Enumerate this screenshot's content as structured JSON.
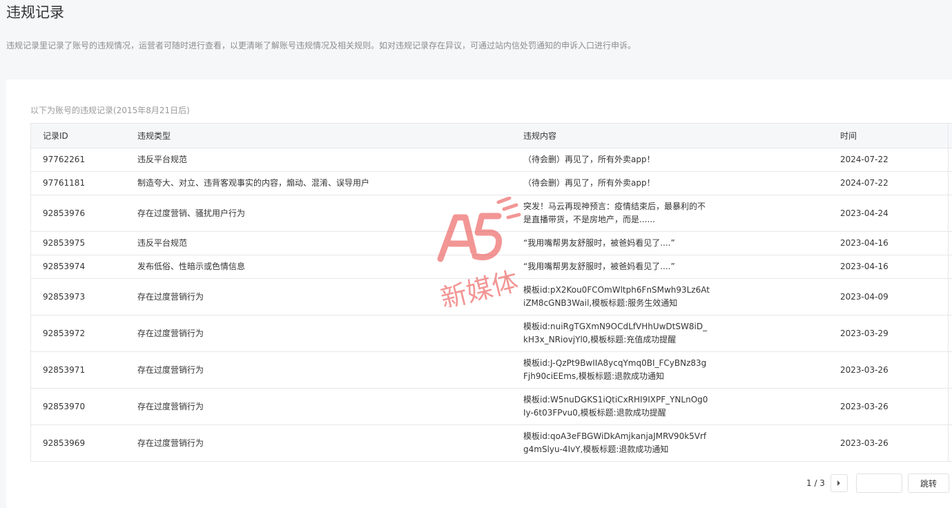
{
  "page": {
    "title": "违规记录",
    "description": "违规记录里记录了账号的违规情况，运营者可随时进行查看，以更清晰了解账号违规情况及相关规则。如对违规记录存在异议，可通过站内信处罚通知的申诉入口进行申诉。"
  },
  "records": {
    "caption": "以下为账号的违规记录(2015年8月21日后)",
    "headers": {
      "id": "记录ID",
      "type": "违规类型",
      "content": "违规内容",
      "time": "时间"
    },
    "rows": [
      {
        "id": "97762261",
        "type": "违反平台规范",
        "content": "（待会删）再见了，所有外卖app！",
        "time": "2024-07-22"
      },
      {
        "id": "97761181",
        "type": "制造夸大、对立、违背客观事实的内容，煽动、混淆、误导用户",
        "content": "（待会删）再见了，所有外卖app！",
        "time": "2024-07-22"
      },
      {
        "id": "92853976",
        "type": "存在过度营销、骚扰用户行为",
        "content": "突发！马云再现神预言：疫情结束后，最暴利的不是直播带货，不是房地产，而是......",
        "time": "2023-04-24"
      },
      {
        "id": "92853975",
        "type": "违反平台规范",
        "content": "“我用嘴帮男友舒服时，被爸妈看见了....”",
        "time": "2023-04-16"
      },
      {
        "id": "92853974",
        "type": "发布低俗、性暗示或色情信息",
        "content": "“我用嘴帮男友舒服时，被爸妈看见了....”",
        "time": "2023-04-16"
      },
      {
        "id": "92853973",
        "type": "存在过度营销行为",
        "content": "模板id:pX2Kou0FCOmWltph6FnSMwh93Lz6AtiZM8cGNB3Wail,模板标题:服务生效通知",
        "time": "2023-04-09"
      },
      {
        "id": "92853972",
        "type": "存在过度营销行为",
        "content": "模板id:nuiRgTGXmN9OCdLfVHhUwDtSW8iD_kH3x_NRiovjYl0,模板标题:充值成功提醒",
        "time": "2023-03-29"
      },
      {
        "id": "92853971",
        "type": "存在过度营销行为",
        "content": "模板id:J-QzPt9BwIIA8ycqYmq0BI_FCyBNz83gFjh90ciEEms,模板标题:退款成功通知",
        "time": "2023-03-26"
      },
      {
        "id": "92853970",
        "type": "存在过度营销行为",
        "content": "模板id:W5nuDGKS1iQtiCxRHI9IXPF_YNLnOg0Iy-6t03FPvu0,模板标题:退款成功提醒",
        "time": "2023-03-26"
      },
      {
        "id": "92853969",
        "type": "存在过度营销行为",
        "content": "模板id:qoA3eFBGWiDkAmjkanjaJMRV90k5Vrfg4mSlyu-4IvY,模板标题:退款成功通知",
        "time": "2023-03-26"
      }
    ]
  },
  "pager": {
    "current": "1 / 3",
    "input_value": "",
    "jump_label": "跳转",
    "next_icon": "chevron-right-icon"
  },
  "watermark": {
    "text": "新媒体",
    "logo": "A5",
    "color": "#e8423f"
  }
}
